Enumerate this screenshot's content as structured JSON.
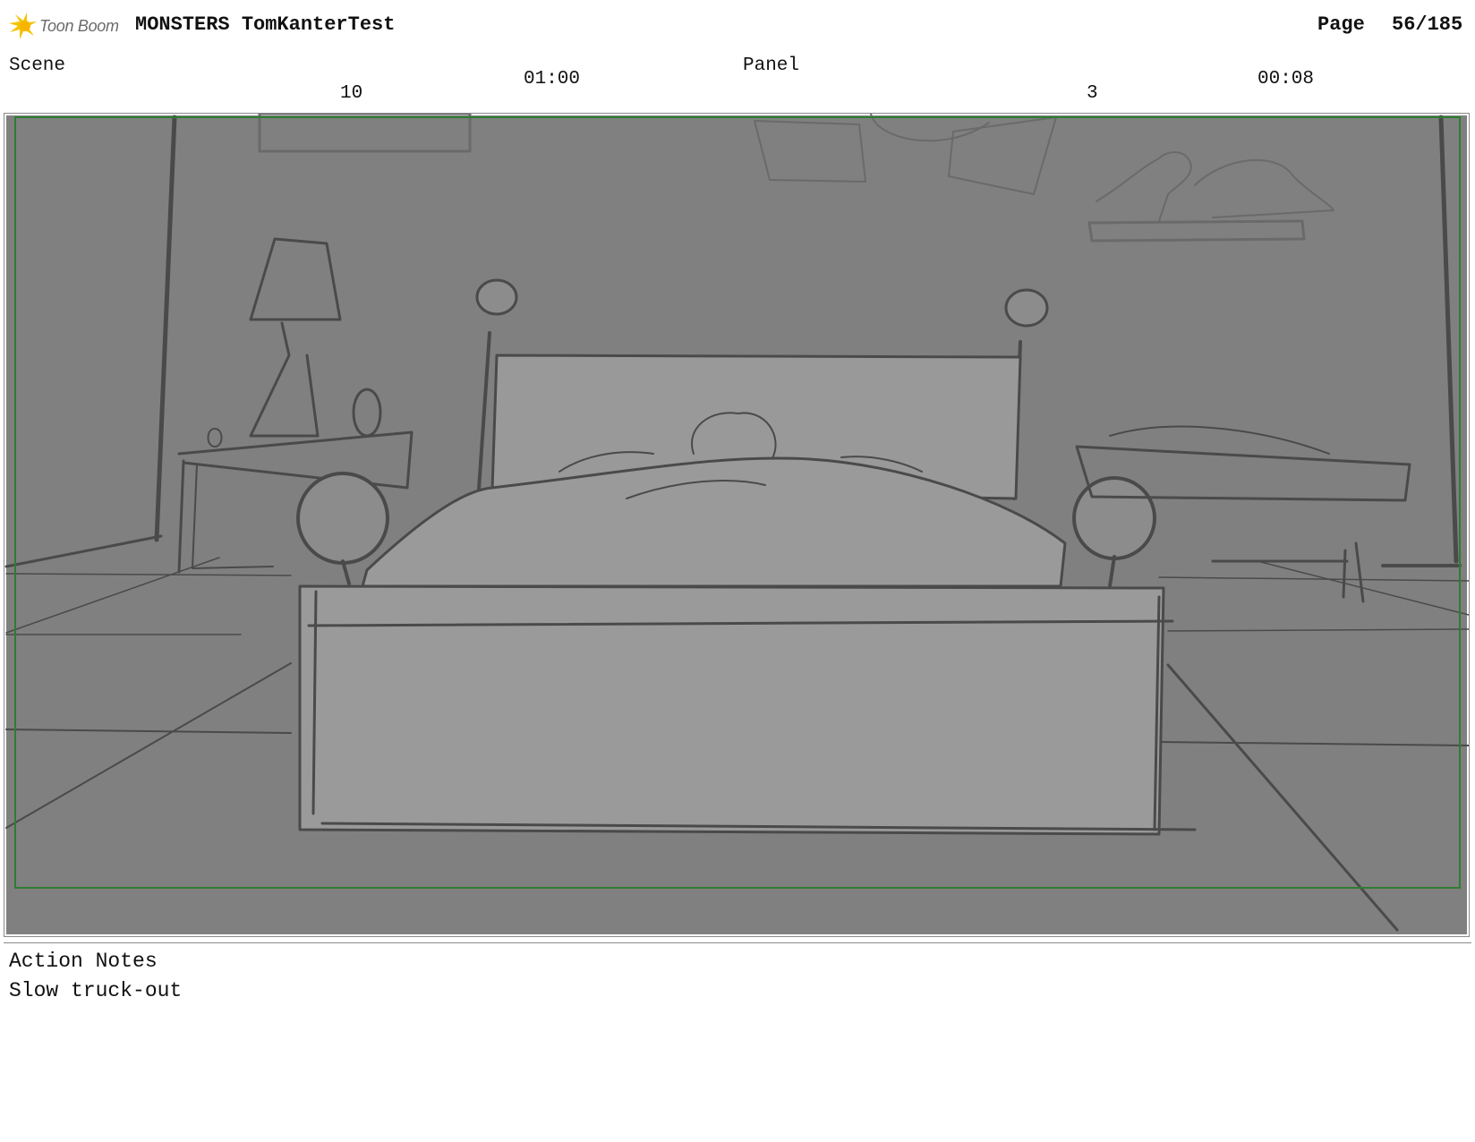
{
  "header": {
    "brand": "Toon Boom",
    "project_title": "MONSTERS TomKanterTest",
    "page_label": "Page",
    "page_value": "56/185"
  },
  "info": {
    "scene_label": "Scene",
    "scene_number": "10",
    "scene_duration": "01:00",
    "panel_label": "Panel",
    "panel_number": "3",
    "panel_duration": "00:08"
  },
  "panel_image": {
    "description_icon": "storyboard-sketch-bedroom",
    "safe_area_color": "#2e7d32",
    "background_color": "#808080"
  },
  "notes": {
    "label": "Action Notes",
    "text": "Slow truck-out"
  }
}
